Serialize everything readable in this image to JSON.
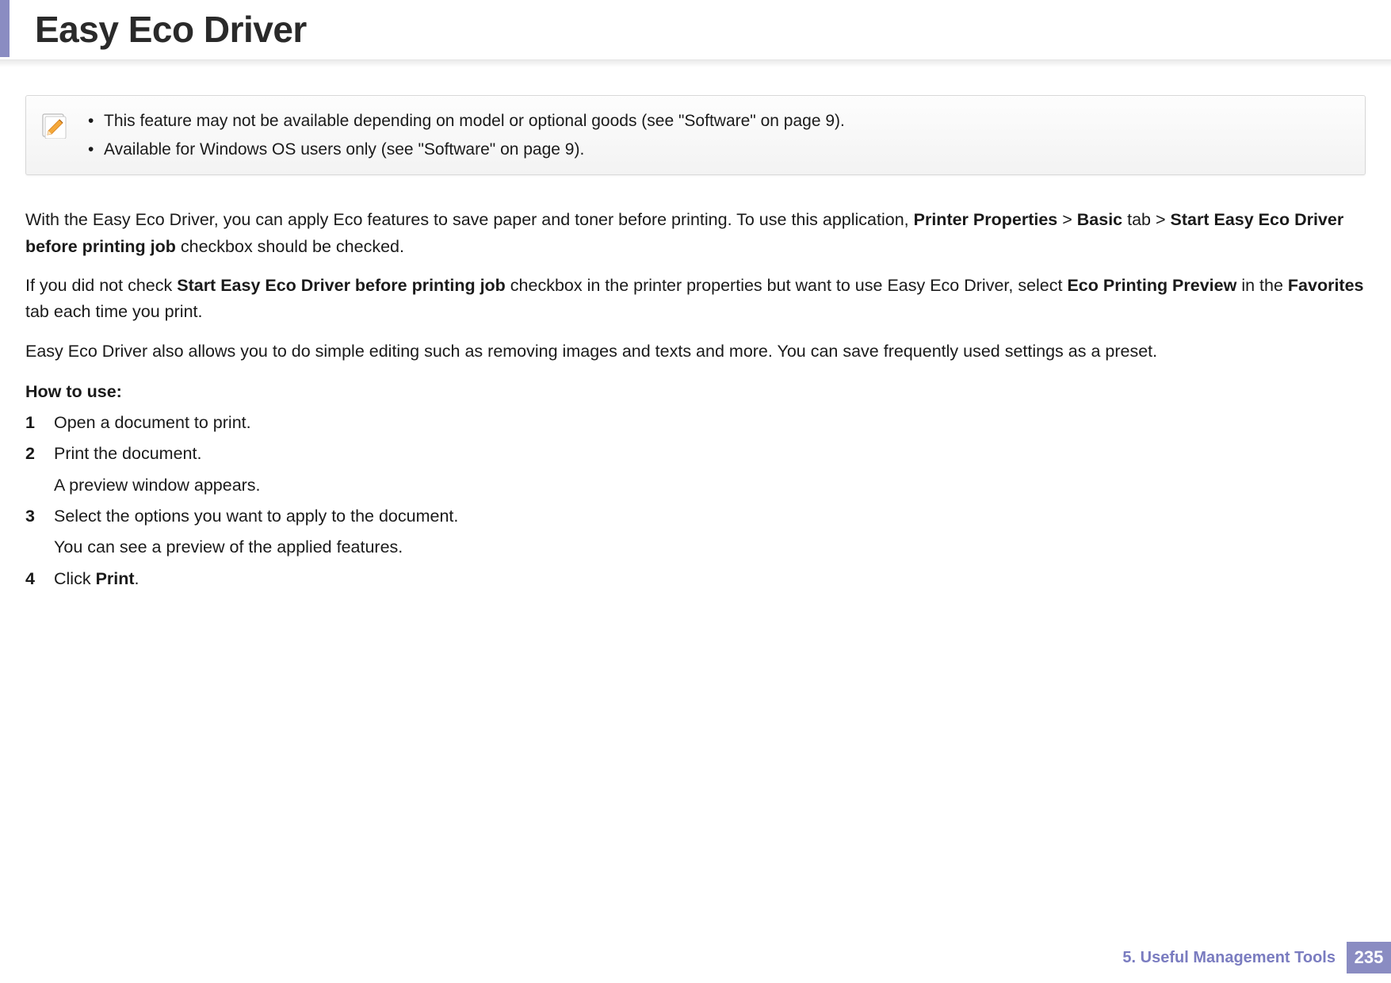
{
  "header": {
    "title": "Easy Eco Driver"
  },
  "note": {
    "items": [
      "This feature may not be available depending on model or optional goods (see \"Software\" on page 9).",
      "Available for Windows OS users only (see \"Software\" on page 9)."
    ]
  },
  "para1": {
    "pre": "With the Easy Eco Driver, you can apply Eco features to save paper and toner before printing. To use this application, ",
    "b1": "Printer Properties",
    "gt1": " > ",
    "b2": "Basic",
    "mid1": " tab > ",
    "b3": "Start Easy Eco Driver before printing job",
    "post": " checkbox should be checked."
  },
  "para2": {
    "pre": "If you did not check ",
    "b1": "Start Easy Eco Driver before printing job",
    "mid1": " checkbox in the printer properties but want to use Easy Eco Driver, select ",
    "b2": "Eco Printing Preview",
    "mid2": " in the ",
    "b3": "Favorites",
    "post": " tab each time you print."
  },
  "para3": "Easy Eco Driver also allows you to do simple editing such as removing images and texts and more. You can save frequently used settings as a preset.",
  "howto_heading": "How to use:",
  "steps": [
    {
      "num": "1",
      "text": "Open a document to print."
    },
    {
      "num": "2",
      "text": "Print the document.",
      "sub": "A preview window appears."
    },
    {
      "num": "3",
      "text": "Select the options you want to apply to the document.",
      "sub": "You can see a preview of the applied features."
    },
    {
      "num": "4",
      "text_pre": "Click ",
      "text_bold": "Print",
      "text_post": "."
    }
  ],
  "footer": {
    "chapter": "5.  Useful Management Tools",
    "page": "235"
  }
}
